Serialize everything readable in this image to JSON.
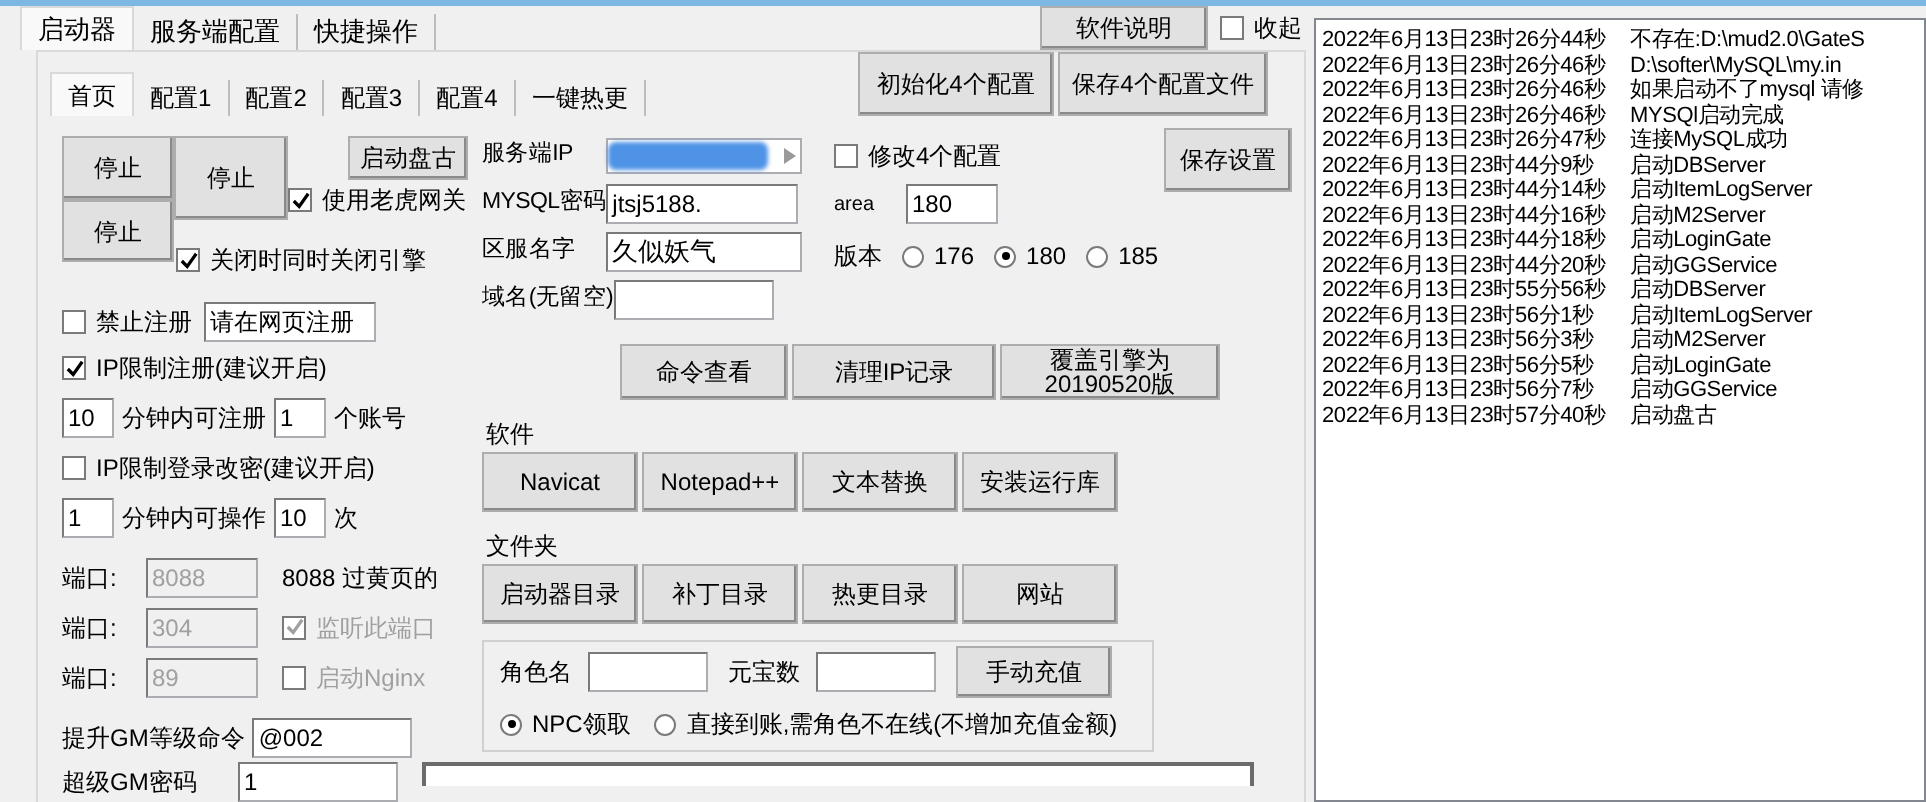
{
  "window_tabs": [
    {
      "label": "启动器",
      "selected": true
    },
    {
      "label": "服务端配置",
      "selected": false
    },
    {
      "label": "快捷操作",
      "selected": false
    }
  ],
  "help_button": "软件说明",
  "collapse": {
    "label": "收起",
    "checked": false
  },
  "sub_tabs": [
    {
      "label": "首页",
      "selected": true
    },
    {
      "label": "配置1",
      "selected": false
    },
    {
      "label": "配置2",
      "selected": false
    },
    {
      "label": "配置3",
      "selected": false
    },
    {
      "label": "配置4",
      "selected": false
    },
    {
      "label": "一键热更",
      "selected": false
    }
  ],
  "init_button": "初始化4个配置",
  "save_configs_button": "保存4个配置文件",
  "stop_buttons": [
    "停止",
    "停止",
    "停止"
  ],
  "start_pangu_button": "启动盘古",
  "use_tiger_gateway": {
    "label": "使用老虎网关",
    "checked": true
  },
  "close_engine": {
    "label": "关闭时同时关闭引擎",
    "checked": true
  },
  "disable_register": {
    "label": "禁止注册",
    "checked": false,
    "message": "请在网页注册"
  },
  "ip_limit_register": {
    "label": "IP限制注册(建议开启)",
    "checked": true
  },
  "register_rate": {
    "minutes": "10",
    "minutes_label": "分钟内可注册",
    "count": "1",
    "count_label": "个账号"
  },
  "ip_limit_login": {
    "label": "IP限制登录改密(建议开启)",
    "checked": false
  },
  "operate_rate": {
    "minutes": "1",
    "minutes_label": "分钟内可操作",
    "count": "10",
    "count_label": "次"
  },
  "ports": [
    {
      "label": "端口:",
      "value": "8088",
      "disabled": true,
      "kind": "note",
      "note": "8088 过黄页的"
    },
    {
      "label": "端口:",
      "value": "304",
      "disabled": true,
      "kind": "checkbox",
      "option": {
        "label": "监听此端口",
        "checked": true,
        "disabled": true
      }
    },
    {
      "label": "端口:",
      "value": "89",
      "disabled": true,
      "kind": "checkbox",
      "option": {
        "label": "启动Nginx",
        "checked": false,
        "disabled": true
      }
    }
  ],
  "gm_command": {
    "label": "提升GM等级命令",
    "value": "@002"
  },
  "super_gm_password": {
    "label": "超级GM密码",
    "value": "1"
  },
  "server_ip": {
    "label": "服务端IP"
  },
  "mysql": {
    "label": "MYSQL密码",
    "value": "jtsj5188."
  },
  "zone_name": {
    "label": "区服名字",
    "value": "久似妖气"
  },
  "domain": {
    "label": "域名(无留空)"
  },
  "modify_configs": {
    "label": "修改4个配置",
    "checked": false
  },
  "area": {
    "label": "area",
    "value": "180"
  },
  "version": {
    "label": "版本",
    "options": [
      {
        "label": "176",
        "selected": false
      },
      {
        "label": "180",
        "selected": true
      },
      {
        "label": "185",
        "selected": false
      }
    ]
  },
  "save_settings_button": "保存设置",
  "action_buttons": [
    "命令查看",
    "清理IP记录",
    "覆盖引擎为20190520版"
  ],
  "software": {
    "label": "软件",
    "buttons": [
      "Navicat",
      "Notepad++",
      "文本替换",
      "安装运行库"
    ]
  },
  "folders": {
    "label": "文件夹",
    "buttons": [
      "启动器目录",
      "补丁目录",
      "热更目录",
      "网站"
    ]
  },
  "recharge": {
    "role_label": "角色名",
    "ingot_label": "元宝数",
    "button": "手动充值",
    "modes": [
      {
        "label": "NPC领取",
        "selected": true
      },
      {
        "label": "直接到账,需角色不在线(不增加充值金额)",
        "selected": false
      }
    ]
  },
  "log": [
    {
      "time": "2022年6月13日23时26分44秒",
      "message": "不存在:D:\\mud2.0\\GateS"
    },
    {
      "time": "2022年6月13日23时26分46秒",
      "message": "D:\\softer\\MySQL\\my.in"
    },
    {
      "time": "2022年6月13日23时26分46秒",
      "message": "如果启动不了mysql 请修"
    },
    {
      "time": "2022年6月13日23时26分46秒",
      "message": "MYSQl启动完成"
    },
    {
      "time": "2022年6月13日23时26分47秒",
      "message": "连接MySQL成功"
    },
    {
      "time": "2022年6月13日23时44分9秒",
      "message": "启动DBServer"
    },
    {
      "time": "2022年6月13日23时44分14秒",
      "message": "启动ItemLogServer"
    },
    {
      "time": "2022年6月13日23时44分16秒",
      "message": "启动M2Server"
    },
    {
      "time": "2022年6月13日23时44分18秒",
      "message": "启动LoginGate"
    },
    {
      "time": "2022年6月13日23时44分20秒",
      "message": "启动GGService"
    },
    {
      "time": "2022年6月13日23时55分56秒",
      "message": "启动DBServer"
    },
    {
      "time": "2022年6月13日23时56分1秒",
      "message": "启动ItemLogServer"
    },
    {
      "time": "2022年6月13日23时56分3秒",
      "message": "启动M2Server"
    },
    {
      "time": "2022年6月13日23时56分5秒",
      "message": "启动LoginGate"
    },
    {
      "time": "2022年6月13日23时56分7秒",
      "message": "启动GGService"
    },
    {
      "time": "2022年6月13日23时57分40秒",
      "message": "启动盘古"
    }
  ]
}
